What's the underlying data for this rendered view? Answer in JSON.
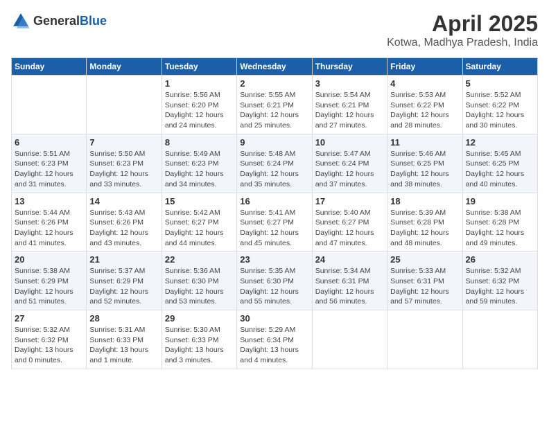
{
  "header": {
    "logo_general": "General",
    "logo_blue": "Blue",
    "month_title": "April 2025",
    "location": "Kotwa, Madhya Pradesh, India"
  },
  "weekdays": [
    "Sunday",
    "Monday",
    "Tuesday",
    "Wednesday",
    "Thursday",
    "Friday",
    "Saturday"
  ],
  "weeks": [
    [
      {
        "day": "",
        "info": ""
      },
      {
        "day": "",
        "info": ""
      },
      {
        "day": "1",
        "info": "Sunrise: 5:56 AM\nSunset: 6:20 PM\nDaylight: 12 hours\nand 24 minutes."
      },
      {
        "day": "2",
        "info": "Sunrise: 5:55 AM\nSunset: 6:21 PM\nDaylight: 12 hours\nand 25 minutes."
      },
      {
        "day": "3",
        "info": "Sunrise: 5:54 AM\nSunset: 6:21 PM\nDaylight: 12 hours\nand 27 minutes."
      },
      {
        "day": "4",
        "info": "Sunrise: 5:53 AM\nSunset: 6:22 PM\nDaylight: 12 hours\nand 28 minutes."
      },
      {
        "day": "5",
        "info": "Sunrise: 5:52 AM\nSunset: 6:22 PM\nDaylight: 12 hours\nand 30 minutes."
      }
    ],
    [
      {
        "day": "6",
        "info": "Sunrise: 5:51 AM\nSunset: 6:23 PM\nDaylight: 12 hours\nand 31 minutes."
      },
      {
        "day": "7",
        "info": "Sunrise: 5:50 AM\nSunset: 6:23 PM\nDaylight: 12 hours\nand 33 minutes."
      },
      {
        "day": "8",
        "info": "Sunrise: 5:49 AM\nSunset: 6:23 PM\nDaylight: 12 hours\nand 34 minutes."
      },
      {
        "day": "9",
        "info": "Sunrise: 5:48 AM\nSunset: 6:24 PM\nDaylight: 12 hours\nand 35 minutes."
      },
      {
        "day": "10",
        "info": "Sunrise: 5:47 AM\nSunset: 6:24 PM\nDaylight: 12 hours\nand 37 minutes."
      },
      {
        "day": "11",
        "info": "Sunrise: 5:46 AM\nSunset: 6:25 PM\nDaylight: 12 hours\nand 38 minutes."
      },
      {
        "day": "12",
        "info": "Sunrise: 5:45 AM\nSunset: 6:25 PM\nDaylight: 12 hours\nand 40 minutes."
      }
    ],
    [
      {
        "day": "13",
        "info": "Sunrise: 5:44 AM\nSunset: 6:26 PM\nDaylight: 12 hours\nand 41 minutes."
      },
      {
        "day": "14",
        "info": "Sunrise: 5:43 AM\nSunset: 6:26 PM\nDaylight: 12 hours\nand 43 minutes."
      },
      {
        "day": "15",
        "info": "Sunrise: 5:42 AM\nSunset: 6:27 PM\nDaylight: 12 hours\nand 44 minutes."
      },
      {
        "day": "16",
        "info": "Sunrise: 5:41 AM\nSunset: 6:27 PM\nDaylight: 12 hours\nand 45 minutes."
      },
      {
        "day": "17",
        "info": "Sunrise: 5:40 AM\nSunset: 6:27 PM\nDaylight: 12 hours\nand 47 minutes."
      },
      {
        "day": "18",
        "info": "Sunrise: 5:39 AM\nSunset: 6:28 PM\nDaylight: 12 hours\nand 48 minutes."
      },
      {
        "day": "19",
        "info": "Sunrise: 5:38 AM\nSunset: 6:28 PM\nDaylight: 12 hours\nand 49 minutes."
      }
    ],
    [
      {
        "day": "20",
        "info": "Sunrise: 5:38 AM\nSunset: 6:29 PM\nDaylight: 12 hours\nand 51 minutes."
      },
      {
        "day": "21",
        "info": "Sunrise: 5:37 AM\nSunset: 6:29 PM\nDaylight: 12 hours\nand 52 minutes."
      },
      {
        "day": "22",
        "info": "Sunrise: 5:36 AM\nSunset: 6:30 PM\nDaylight: 12 hours\nand 53 minutes."
      },
      {
        "day": "23",
        "info": "Sunrise: 5:35 AM\nSunset: 6:30 PM\nDaylight: 12 hours\nand 55 minutes."
      },
      {
        "day": "24",
        "info": "Sunrise: 5:34 AM\nSunset: 6:31 PM\nDaylight: 12 hours\nand 56 minutes."
      },
      {
        "day": "25",
        "info": "Sunrise: 5:33 AM\nSunset: 6:31 PM\nDaylight: 12 hours\nand 57 minutes."
      },
      {
        "day": "26",
        "info": "Sunrise: 5:32 AM\nSunset: 6:32 PM\nDaylight: 12 hours\nand 59 minutes."
      }
    ],
    [
      {
        "day": "27",
        "info": "Sunrise: 5:32 AM\nSunset: 6:32 PM\nDaylight: 13 hours\nand 0 minutes."
      },
      {
        "day": "28",
        "info": "Sunrise: 5:31 AM\nSunset: 6:33 PM\nDaylight: 13 hours\nand 1 minute."
      },
      {
        "day": "29",
        "info": "Sunrise: 5:30 AM\nSunset: 6:33 PM\nDaylight: 13 hours\nand 3 minutes."
      },
      {
        "day": "30",
        "info": "Sunrise: 5:29 AM\nSunset: 6:34 PM\nDaylight: 13 hours\nand 4 minutes."
      },
      {
        "day": "",
        "info": ""
      },
      {
        "day": "",
        "info": ""
      },
      {
        "day": "",
        "info": ""
      }
    ]
  ]
}
